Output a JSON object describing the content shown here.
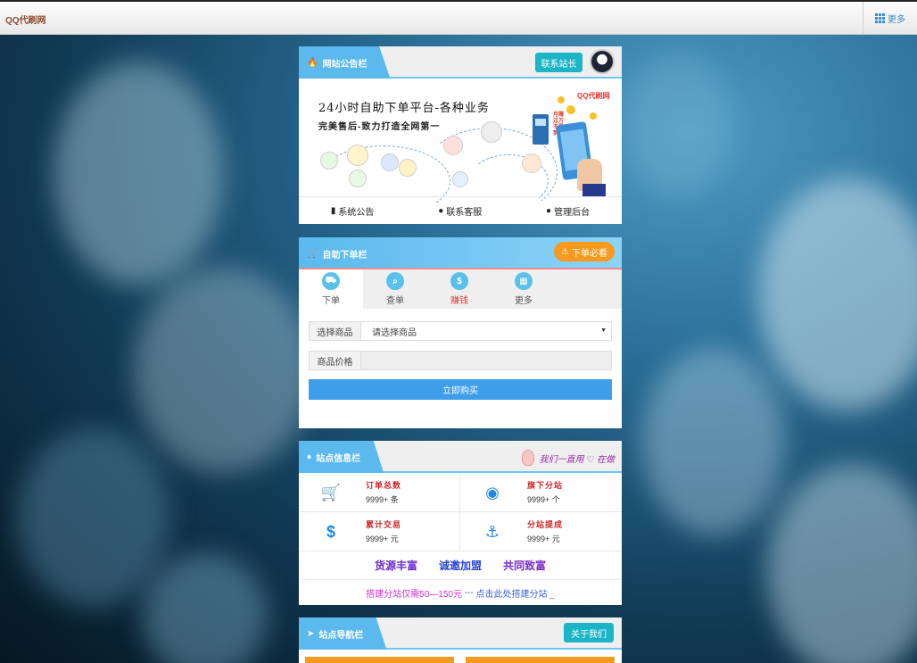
{
  "topbar": {
    "brand": "QQ代刷网",
    "more_label": "更多"
  },
  "notice": {
    "title": "网站公告栏",
    "contact_button": "联系站长",
    "banner_line1": "24小时自助下单平台-各种业务",
    "banner_line2": "完美售后-致力打造全网第一",
    "banner_logo": "QQ代刷网",
    "banner_side": "月赚过万不是梦！",
    "links": [
      {
        "icon": "file-icon",
        "label": "系统公告"
      },
      {
        "icon": "qq-icon",
        "label": "联系客服"
      },
      {
        "icon": "user-icon",
        "label": "管理后台"
      }
    ]
  },
  "order": {
    "title": "自助下单栏",
    "must_read": "下单必看",
    "tabs": [
      {
        "icon": "cart-icon",
        "label": "下单",
        "color": "#555555"
      },
      {
        "icon": "search-icon",
        "label": "查单",
        "color": "#555555"
      },
      {
        "icon": "dollar-icon",
        "label": "赚钱",
        "color": "#e53935"
      },
      {
        "icon": "apps-icon",
        "label": "更多",
        "color": "#555555"
      }
    ],
    "product_label": "选择商品",
    "product_value": "请选择商品",
    "price_label": "商品价格",
    "price_value": "",
    "buy_button": "立即购买"
  },
  "stats": {
    "title": "站点信息栏",
    "slogan": "我们一直用 ♡ 在做",
    "items": [
      {
        "icon": "cart-icon",
        "label": "订单总数",
        "value": "9999+ 条"
      },
      {
        "icon": "firefox-icon",
        "label": "旗下分站",
        "value": "9999+ 个"
      },
      {
        "icon": "dollar-icon",
        "label": "累计交易",
        "value": "9999+ 元"
      },
      {
        "icon": "anchor-icon",
        "label": "分站提成",
        "value": "9999+ 元"
      }
    ],
    "tags": [
      "货源丰富",
      "诚邀加盟",
      "共同致富"
    ],
    "promo_a": "搭建分站仅需50—150元",
    "promo_sep": " --- ",
    "promo_b": "点击此处搭建分站 _"
  },
  "nav": {
    "title": "站点导航栏",
    "about_button": "关于我们"
  },
  "colors": {
    "accent": "#5bb9ee",
    "buy": "#3f9ee9",
    "orange": "#f59a1d",
    "cyan": "#1cb5c8"
  }
}
